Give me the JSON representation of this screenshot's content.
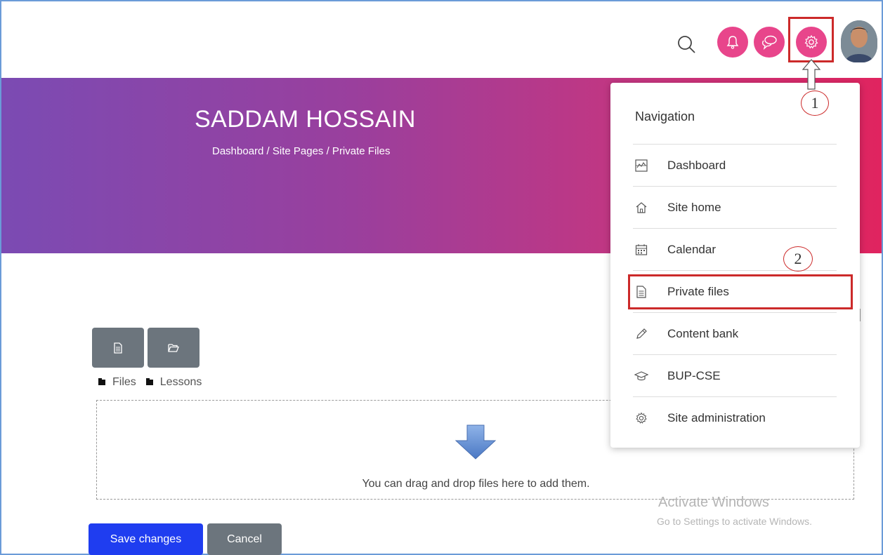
{
  "hero": {
    "title": "SADDAM HOSSAIN",
    "breadcrumb": "Dashboard / Site Pages / Private Files"
  },
  "topbar": {
    "icons": [
      "search-icon",
      "bell-icon",
      "chat-icon",
      "gear-icon",
      "avatar"
    ]
  },
  "navigation": {
    "heading": "Navigation",
    "items": [
      {
        "label": "Dashboard",
        "icon": "dashboard-icon"
      },
      {
        "label": "Site home",
        "icon": "home-icon"
      },
      {
        "label": "Calendar",
        "icon": "calendar-icon"
      },
      {
        "label": "Private files",
        "icon": "file-icon"
      },
      {
        "label": "Content bank",
        "icon": "pencil-icon"
      },
      {
        "label": "BUP-CSE",
        "icon": "graduation-cap-icon"
      },
      {
        "label": "Site administration",
        "icon": "gear-icon"
      }
    ]
  },
  "filemanager": {
    "path": [
      "Files",
      "Lessons"
    ],
    "dropzone_text": "You can drag and drop files here to add them."
  },
  "buttons": {
    "save": "Save changes",
    "cancel": "Cancel"
  },
  "annotations": {
    "step1": "1",
    "step2": "2"
  },
  "watermark": {
    "title": "Activate Windows",
    "subtitle": "Go to Settings to activate Windows."
  },
  "colors": {
    "accent_pink": "#e8458b",
    "highlight_red": "#cc2a2a",
    "primary_blue": "#1f3df0",
    "secondary_gray": "#6c757d"
  }
}
